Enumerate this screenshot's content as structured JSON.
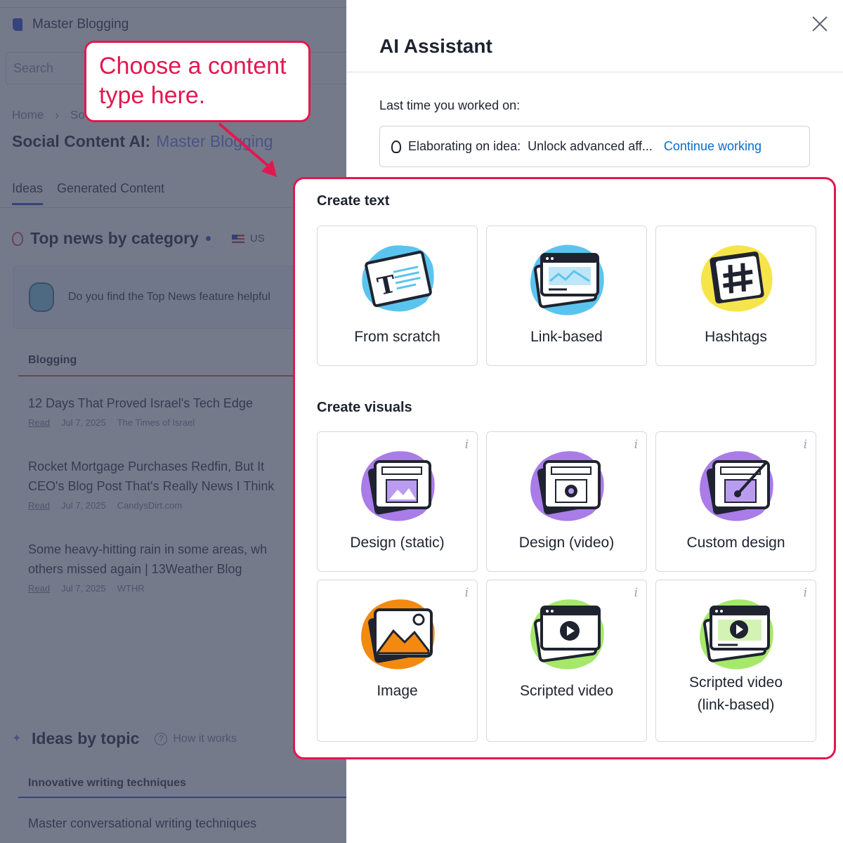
{
  "background": {
    "brand": "Master Blogging",
    "search_placeholder": "Search",
    "breadcrumb": [
      "Home",
      "So"
    ],
    "page_title": "Social Content AI:",
    "project_name": "Master Blogging",
    "tabs": [
      "Ideas",
      "Generated Content"
    ],
    "top_news_heading": "Top news by category",
    "region": "US",
    "feedback_text": "Do you find the Top News feature helpful",
    "category_tab": "Blogging",
    "news": [
      {
        "title1": "12 Days That Proved Israel's Tech Edge",
        "title2": "",
        "read": "Read",
        "date": "Jul 7, 2025",
        "source": "The Times of Israel"
      },
      {
        "title1": "Rocket Mortgage Purchases Redfin, But It",
        "title2": "CEO's Blog Post That's Really News I Think",
        "read": "Read",
        "date": "Jul 7, 2025",
        "source": "CandysDirt.com"
      },
      {
        "title1": "Some heavy-hitting rain in some areas, wh",
        "title2": "others missed again | 13Weather Blog",
        "read": "Read",
        "date": "Jul 7, 2025",
        "source": "WTHR"
      }
    ],
    "ideas_heading": "Ideas by topic",
    "how_it_works": "How it works",
    "topic_tab": "Innovative writing techniques",
    "topic_item": "Master conversational writing techniques"
  },
  "callout": {
    "line1": "Choose a content",
    "line2": "type here."
  },
  "panel": {
    "title": "AI Assistant",
    "last_label": "Last time you worked on:",
    "idea_label": "Elaborating on idea:",
    "idea_value": "Unlock advanced aff...",
    "continue_label": "Continue working",
    "create_text_title": "Create text",
    "create_visuals_title": "Create visuals",
    "text_cards": [
      {
        "label": "From scratch",
        "icon": "text-document-icon"
      },
      {
        "label": "Link-based",
        "icon": "browser-window-icon"
      },
      {
        "label": "Hashtags",
        "icon": "hashtag-icon"
      }
    ],
    "visual_cards": [
      {
        "label": "Design (static)",
        "icon": "design-static-icon",
        "info": "i"
      },
      {
        "label": "Design (video)",
        "icon": "design-video-icon",
        "info": "i"
      },
      {
        "label": "Custom design",
        "icon": "custom-design-icon",
        "info": "i"
      },
      {
        "label": "Image",
        "icon": "image-icon",
        "info": "i"
      },
      {
        "label": "Scripted video",
        "icon": "scripted-video-icon",
        "info": "i"
      },
      {
        "label": "Scripted video",
        "label2": "(link-based)",
        "icon": "scripted-video-link-icon",
        "info": "i"
      }
    ]
  },
  "colors": {
    "accent_red": "#e3174f",
    "link_blue": "#0b6bcb",
    "blob_blue": "#5bc4ee",
    "blob_yellow": "#f6e44b",
    "blob_purple": "#a97ce8",
    "blob_orange": "#f28a12",
    "blob_green": "#a5e86a"
  }
}
